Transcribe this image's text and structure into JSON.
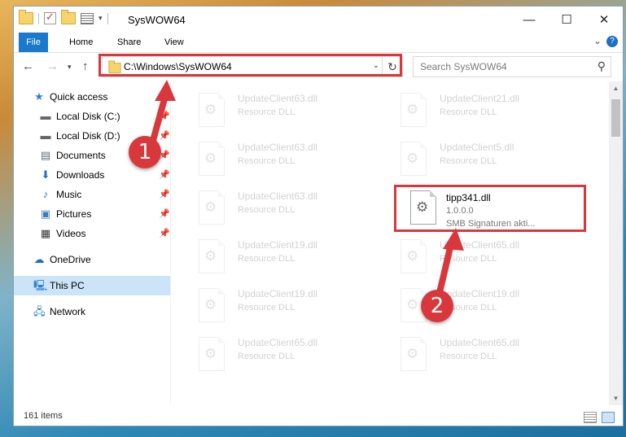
{
  "window": {
    "title": "SysWOW64",
    "controls": {
      "minimize": "—",
      "maximize": "☐",
      "close": "✕"
    }
  },
  "ribbon": {
    "tabs": [
      "File",
      "Home",
      "Share",
      "View"
    ],
    "help": "?"
  },
  "address": {
    "path": "C:\\Windows\\SysWOW64",
    "search_placeholder": "Search SysWOW64"
  },
  "sidebar": {
    "items": [
      {
        "label": "Quick access",
        "icon": "star-icon"
      },
      {
        "label": "Local Disk (C:)",
        "icon": "drive-icon"
      },
      {
        "label": "Local Disk (D:)",
        "icon": "drive-icon"
      },
      {
        "label": "Documents",
        "icon": "documents-icon"
      },
      {
        "label": "Downloads",
        "icon": "downloads-icon"
      },
      {
        "label": "Music",
        "icon": "music-icon"
      },
      {
        "label": "Pictures",
        "icon": "pictures-icon"
      },
      {
        "label": "Videos",
        "icon": "videos-icon"
      },
      {
        "label": "OneDrive",
        "icon": "onedrive-icon"
      },
      {
        "label": "This PC",
        "icon": "pc-icon"
      },
      {
        "label": "Network",
        "icon": "network-icon"
      }
    ]
  },
  "files": {
    "left": [
      {
        "name": "UpdateClient63.dll",
        "desc": "Resource DLL"
      },
      {
        "name": "UpdateClient63.dll",
        "desc": "Resource DLL"
      },
      {
        "name": "UpdateClient63.dll",
        "desc": "Resource DLL"
      },
      {
        "name": "UpdateClient19.dll",
        "desc": "Resource DLL"
      },
      {
        "name": "UpdateClient19.dll",
        "desc": "Resource DLL"
      },
      {
        "name": "UpdateClient65.dll",
        "desc": "Resource DLL"
      }
    ],
    "right": [
      {
        "name": "UpdateClient21.dll",
        "desc": "Resource DLL"
      },
      {
        "name": "UpdateClient5.dll",
        "desc": "Resource DLL"
      },
      {
        "name": "UpdateClient65.dll",
        "desc": "Resource DLL"
      },
      {
        "name": "UpdateClient19.dll",
        "desc": "Resource DLL"
      },
      {
        "name": "UpdateClient65.dll",
        "desc": "Resource DLL"
      }
    ],
    "highlighted": {
      "name": "tipp341.dll",
      "version": "1.0.0.0",
      "desc": "SMB Signaturen akti..."
    }
  },
  "status": {
    "count": "161 items"
  },
  "callouts": {
    "one": "1",
    "two": "2"
  },
  "colors": {
    "accent": "#1979ca",
    "highlight": "#d8383b",
    "selected": "#cce4f7"
  }
}
